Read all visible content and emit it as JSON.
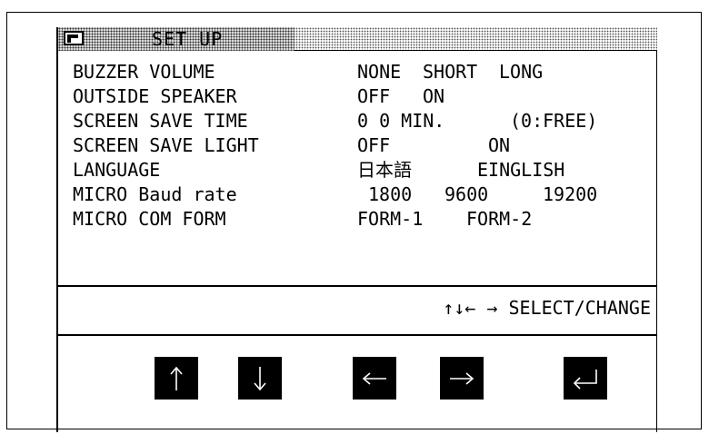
{
  "screen": {
    "title": "SET UP"
  },
  "settings": [
    {
      "label": "BUZZER VOLUME",
      "options": [
        "NONE",
        "SHORT",
        "LONG"
      ]
    },
    {
      "label": "OUTSIDE SPEAKER",
      "options": [
        "OFF",
        "ON"
      ]
    },
    {
      "label": "SCREEN SAVE TIME",
      "options": [
        "0 0 MIN.",
        "(0:FREE)"
      ]
    },
    {
      "label": "SCREEN SAVE LIGHT",
      "options": [
        "OFF",
        "ON"
      ]
    },
    {
      "label": "LANGUAGE",
      "options": [
        "日本語",
        "EINGLISH"
      ]
    },
    {
      "label": "MICRO Baud rate",
      "options": [
        "1800",
        "9600",
        "19200"
      ]
    },
    {
      "label": "MICRO COM FORM",
      "options": [
        "FORM-1",
        "FORM-2"
      ]
    }
  ],
  "hint": "↑↓← → SELECT/CHANGE",
  "keys": {
    "up": "up-arrow-icon",
    "down": "down-arrow-icon",
    "left": "left-arrow-icon",
    "right": "right-arrow-icon",
    "enter": "enter-icon"
  },
  "colors": {
    "key_background": "#000000",
    "key_glyph": "#ffffff",
    "screen_background": "#ffffff"
  }
}
